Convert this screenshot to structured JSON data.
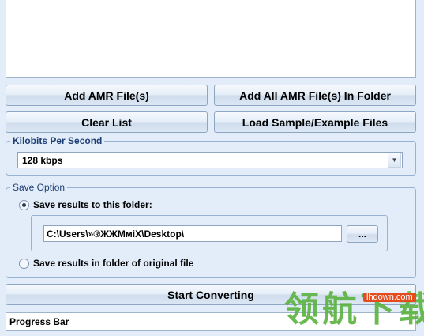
{
  "buttons": {
    "add_amr": "Add AMR File(s)",
    "add_folder": "Add All AMR File(s) In Folder",
    "clear_list": "Clear List",
    "load_sample": "Load Sample/Example Files",
    "browse": "...",
    "start": "Start Converting"
  },
  "kbps": {
    "legend": "Kilobits Per Second",
    "selected": "128 kbps"
  },
  "save": {
    "legend": "Save Option",
    "option_folder": "Save results to this folder:",
    "option_original": "Save results in folder of original file",
    "selected": "option_folder",
    "path": "C:\\Users\\»®ЖЖМміХ\\Desktop\\"
  },
  "progress": {
    "label": "Progress Bar"
  },
  "watermark": {
    "url": "lhdown.com",
    "text": "领航下载"
  }
}
